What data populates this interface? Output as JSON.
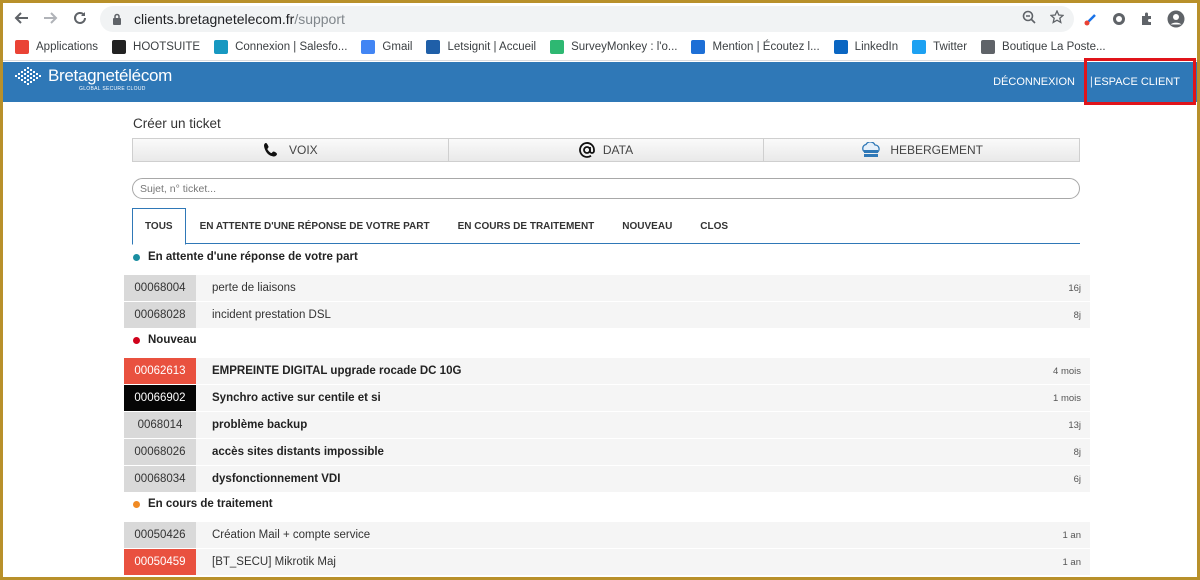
{
  "browser": {
    "url_host": "clients.bretagnetelecom.fr",
    "url_path": "/support",
    "bookmarks": [
      {
        "label": "Applications",
        "icon": "apps-grid-icon",
        "color": "#ea4335"
      },
      {
        "label": "HOOTSUITE",
        "icon": "hootsuite-icon",
        "color": "#222222"
      },
      {
        "label": "Connexion | Salesfo...",
        "icon": "salesforce-icon",
        "color": "#1798c1"
      },
      {
        "label": "Gmail",
        "icon": "google-icon",
        "color": "#4285f4"
      },
      {
        "label": "Letsignit | Accueil",
        "icon": "letsignit-icon",
        "color": "#1f5fa8"
      },
      {
        "label": "SurveyMonkey : l'o...",
        "icon": "surveymonkey-icon",
        "color": "#2eb872"
      },
      {
        "label": "Mention | Écoutez l...",
        "icon": "mention-icon",
        "color": "#1d6fd6"
      },
      {
        "label": "LinkedIn",
        "icon": "linkedin-icon",
        "color": "#0a66c2"
      },
      {
        "label": "Twitter",
        "icon": "twitter-icon",
        "color": "#1da1f2"
      },
      {
        "label": "Boutique La Poste...",
        "icon": "globe-icon",
        "color": "#5f6368"
      }
    ]
  },
  "header": {
    "logo_name_1": "Bretagne",
    "logo_name_2": "télécom",
    "logo_tagline": "GLOBAL SECURE CLOUD",
    "logout_label": "DÉCONNEXION",
    "separator": "|",
    "client_label": "ESPACE CLIENT",
    "color": "#2f78b7"
  },
  "main": {
    "create_title": "Créer un ticket",
    "categories": [
      {
        "label": "VOIX",
        "icon": "phone-icon"
      },
      {
        "label": "DATA",
        "icon": "at-icon"
      },
      {
        "label": "HEBERGEMENT",
        "icon": "cloud-server-icon"
      }
    ],
    "search_placeholder": "Sujet, n° ticket...",
    "tabs": [
      {
        "label": "TOUS",
        "active": true
      },
      {
        "label": "EN ATTENTE D'UNE RÉPONSE DE VOTRE PART",
        "active": false
      },
      {
        "label": "EN COURS DE TRAITEMENT",
        "active": false
      },
      {
        "label": "NOUVEAU",
        "active": false
      },
      {
        "label": "CLOS",
        "active": false
      }
    ],
    "groups": [
      {
        "title": "En attente d'une réponse de votre part",
        "dot_color": "#1a8ea1",
        "tickets": [
          {
            "id": "00068004",
            "subject": "perte de liaisons",
            "age": "16j",
            "style": "grey",
            "bold": false
          },
          {
            "id": "00068028",
            "subject": "incident prestation DSL",
            "age": "8j",
            "style": "grey",
            "bold": false
          }
        ]
      },
      {
        "title": "Nouveau",
        "dot_color": "#d0021b",
        "tickets": [
          {
            "id": "00062613",
            "subject": "EMPREINTE DIGITAL upgrade rocade DC 10G",
            "age": "4 mois",
            "style": "red",
            "bold": true
          },
          {
            "id": "00066902",
            "subject": "Synchro active sur centile et si",
            "age": "1 mois",
            "style": "black",
            "bold": true
          },
          {
            "id": "0068014",
            "subject": "problème backup",
            "age": "13j",
            "style": "grey",
            "bold": true
          },
          {
            "id": "00068026",
            "subject": "accès sites distants impossible",
            "age": "8j",
            "style": "grey",
            "bold": true
          },
          {
            "id": "00068034",
            "subject": "dysfonctionnement VDI",
            "age": "6j",
            "style": "grey",
            "bold": true
          }
        ]
      },
      {
        "title": "En cours de traitement",
        "dot_color": "#f08a24",
        "tickets": [
          {
            "id": "00050426",
            "subject": "Création Mail + compte service",
            "age": "1 an",
            "style": "grey",
            "bold": false
          },
          {
            "id": "00050459",
            "subject": "[BT_SECU] Mikrotik Maj",
            "age": "1 an",
            "style": "red",
            "bold": false
          }
        ]
      }
    ]
  }
}
